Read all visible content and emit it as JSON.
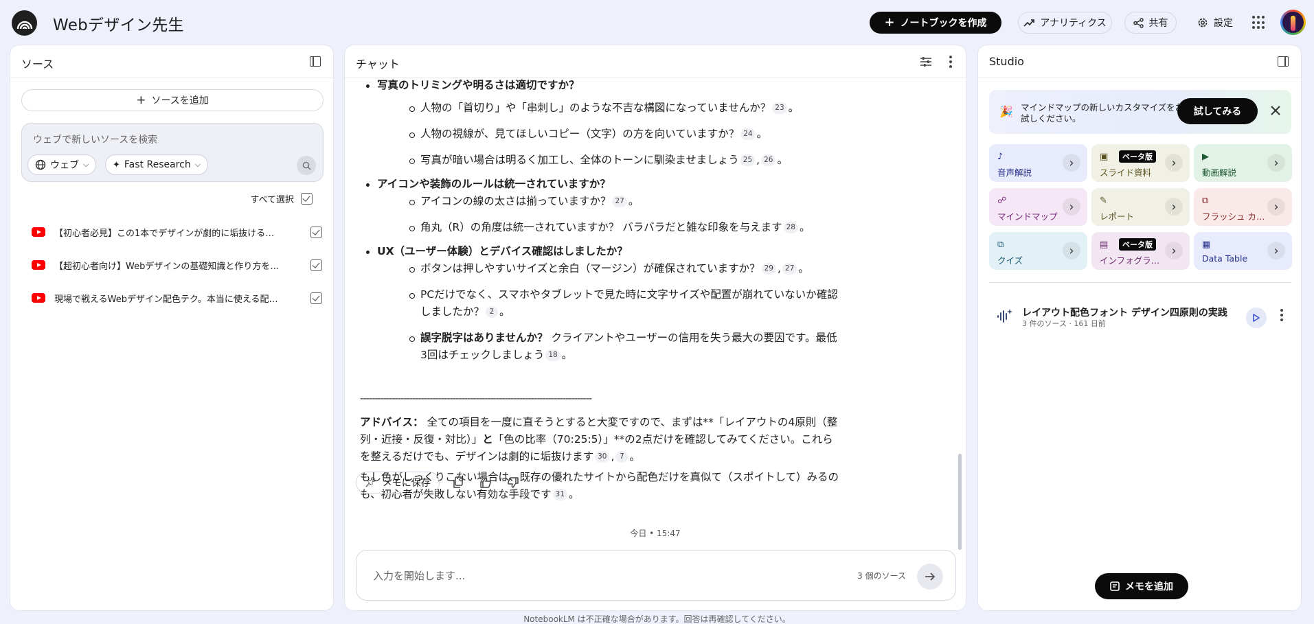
{
  "app": {
    "title": "Webデザイン先生"
  },
  "header": {
    "create_notebook": "ノートブックを作成",
    "analytics": "アナリティクス",
    "share": "共有",
    "settings": "設定"
  },
  "sources": {
    "title": "ソース",
    "add_source": "ソースを追加",
    "search_placeholder": "ウェブで新しいソースを検索",
    "chip_web": "ウェブ",
    "chip_research": "Fast Research",
    "select_all": "すべて選択",
    "items": [
      {
        "label": "【初心者必見】この1本でデザインが劇的に垢抜けるプロのコツ",
        "checked": true
      },
      {
        "label": "【超初心者向け】Webデザインの基礎知識と作り方をわかりやすく解説",
        "checked": true
      },
      {
        "label": "現場で戦えるWebデザイン配色テク。本当に使える配色のルール",
        "checked": true
      }
    ]
  },
  "chat": {
    "title": "チャット",
    "b0_head": "写真のトリミングや明るさは適切ですか？",
    "b0_s1": "人物の「首切り」や「串刺し」のような不吉な構図になっていませんか？",
    "b0_s1_c": "23",
    "b0_s2": "人物の視線が、見てほしいコピー（文字）の方を向いていますか？",
    "b0_s2_c": "24",
    "b0_s3": "写真が暗い場合は明るく加工し、全体のトーンに馴染ませましょう",
    "b0_s3_c1": "25",
    "b0_s3_c2": "26",
    "b1_head": "アイコンや装飾のルールは統一されていますか？",
    "b1_s1": "アイコンの線の太さは揃っていますか？",
    "b1_s1_c": "27",
    "b1_s2": "角丸（R）の角度は統一されていますか？ バラバラだと雑な印象を与えます",
    "b1_s2_c": "28",
    "b2_head": "UX（ユーザー体験）とデバイス確認はしましたか？",
    "b2_s1": "ボタンは押しやすいサイズと余白（マージン）が確保されていますか？",
    "b2_s1_c1": "29",
    "b2_s1_c2": "27",
    "b2_s2": "PCだけでなく、スマホやタブレットで見た時に文字サイズや配置が崩れていないか確認しましたか？",
    "b2_s2_c": "2",
    "b2_s3_bold": "誤字脱字はありませんか？",
    "b2_s3": " クライアントやユーザーの信用を失う最大の要因です。最低3回はチェックしましょう",
    "b2_s3_c": "18",
    "divider": "--------------------------------------------------------------------------------",
    "advice_label": "アドバイス：",
    "advice_text": " 全ての項目を一度に直そうとすると大変ですので、まずは**「レイアウトの4原則（整列・近接・反復・対比）」",
    "advice_and": "と",
    "advice_text2": "「色の比率（70:25:5）」**の2点だけを確認してみてください。これらを整えるだけでも、デザインは劇的に垢抜けます",
    "advice_c1": "30",
    "advice_c2": "7",
    "advice2_text": "もし色がしっくりこない場合は、既存の優れたサイトから配色だけを真似て（スポイトして）みるのも、初心者が失敗しない有効な手段です",
    "advice2_c": "31",
    "save_memo": "メモに保存",
    "timestamp": "今日 • 15:47",
    "input_placeholder": "入力を開始します...",
    "source_count": "3 個のソース",
    "footer": "NotebookLM は不正確な場合があります。回答は再確認してください。"
  },
  "studio": {
    "title": "Studio",
    "banner_text": "マインドマップの新しいカスタマイズをお試しください。",
    "banner_try": "試してみる",
    "beta": "ベータ版",
    "tiles": [
      {
        "label": "音声解説",
        "bg": "#e8ebfb",
        "fg": "#26318c"
      },
      {
        "label": "スライド資料",
        "bg": "#f1f0e4",
        "fg": "#5b5320"
      },
      {
        "label": "動画解説",
        "bg": "#e3f2e7",
        "fg": "#1e5a34"
      },
      {
        "label": "マインドマップ",
        "bg": "#f5e7f5",
        "fg": "#7a2b7a"
      },
      {
        "label": "レポート",
        "bg": "#f0f0e6",
        "fg": "#5b5320"
      },
      {
        "label": "フラッシュ カード",
        "bg": "#f9e9e9",
        "fg": "#8a2a2a"
      },
      {
        "label": "クイズ",
        "bg": "#e2f1f6",
        "fg": "#1b5870"
      },
      {
        "label": "インフォグラフィック",
        "bg": "#f3e6f3",
        "fg": "#6b2b6b"
      },
      {
        "label": "Data Table",
        "bg": "#e8ebfb",
        "fg": "#26318c"
      }
    ],
    "note_title": "レイアウト配色フォント デザイン四原則の実践",
    "note_meta": "3 件のソース · 161 日前",
    "add_memo": "メモを追加"
  }
}
